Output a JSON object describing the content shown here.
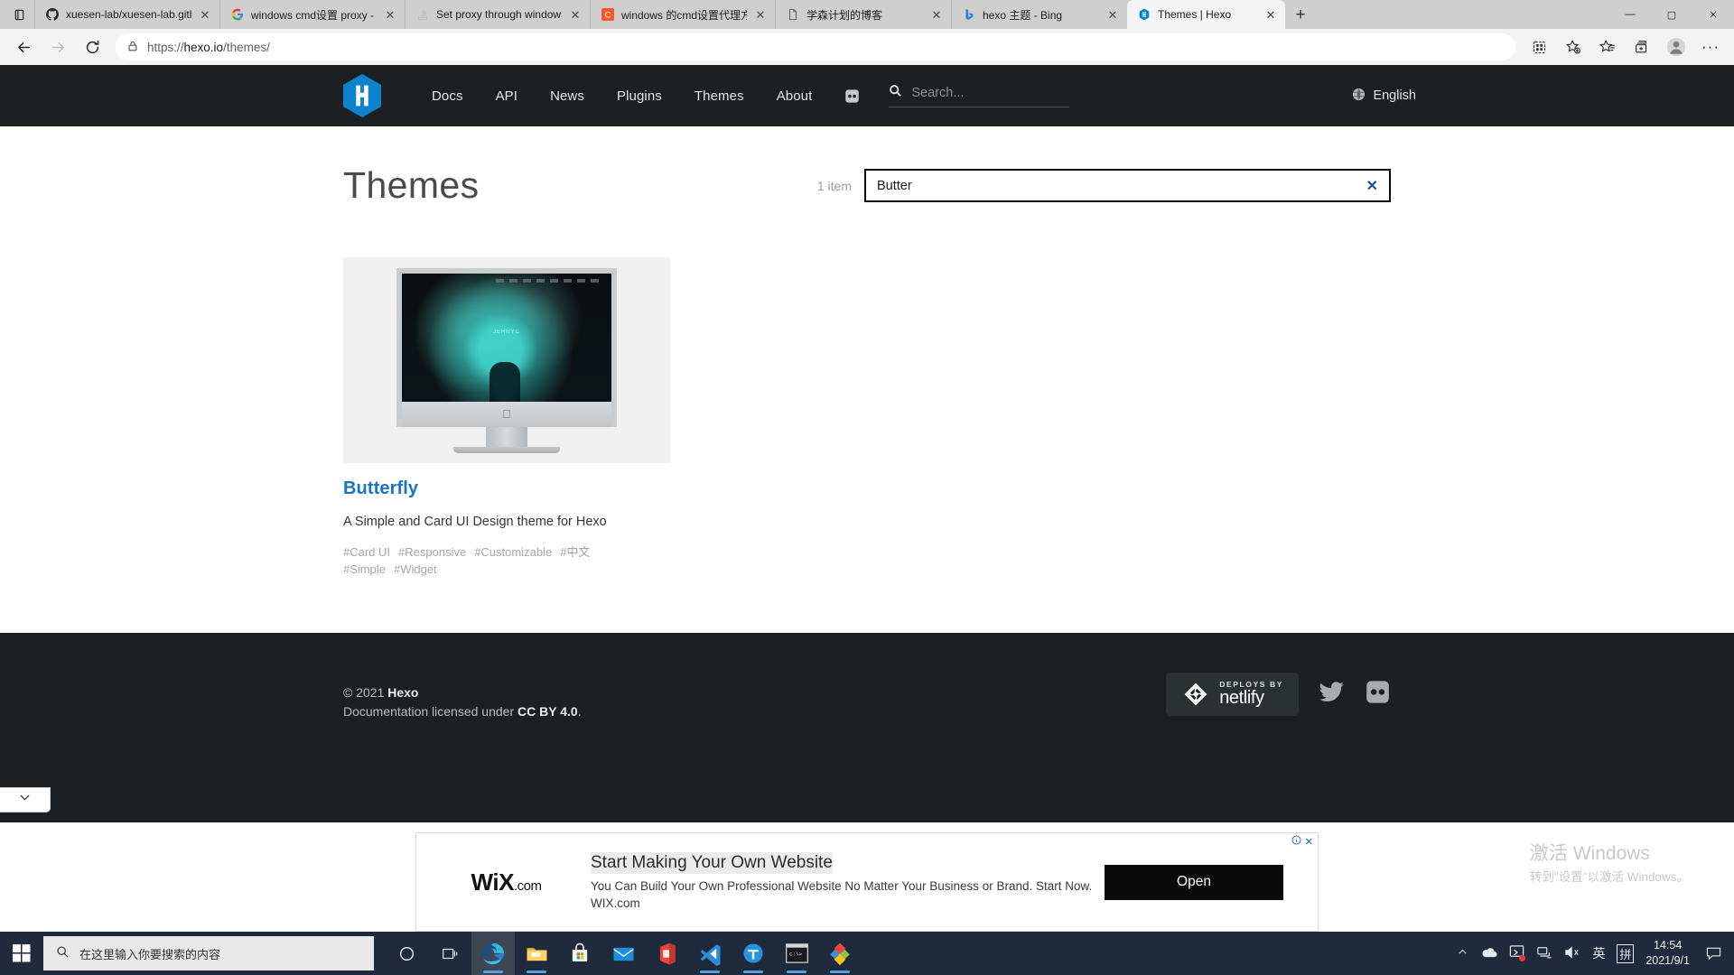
{
  "browser": {
    "tabs": [
      {
        "title": "xuesen-lab/xuesen-lab.github.io",
        "favicon": "github-icon",
        "active": false
      },
      {
        "title": "windows cmd设置 proxy - Goog",
        "favicon": "google-icon",
        "active": false
      },
      {
        "title": "Set proxy through windows com",
        "favicon": "stackoverflow-icon",
        "active": false
      },
      {
        "title": "windows 的cmd设置代理方法_场",
        "favicon": "csdn-icon",
        "active": false
      },
      {
        "title": "学森计划的博客",
        "favicon": "page-icon",
        "active": false
      },
      {
        "title": "hexo 主题 - Bing",
        "favicon": "bing-icon",
        "active": false
      },
      {
        "title": "Themes | Hexo",
        "favicon": "hexo-icon",
        "active": true
      }
    ],
    "newtab_label": "+",
    "window_controls": {
      "minimize": "—",
      "maximize": "▢",
      "close": "✕"
    },
    "toolbar": {
      "back_label": "←",
      "forward_label": "→",
      "reload_label": "⟳",
      "url": "https://hexo.io/themes/",
      "url_host": "hexo.io",
      "url_scheme": "https://",
      "url_path": "/themes/",
      "lock_icon": "lock-icon",
      "right_icons": [
        "collections-grid-icon",
        "add-favorite-icon",
        "favorites-icon",
        "collections-icon",
        "profile-icon",
        "settings-more-icon"
      ],
      "more_label": "···"
    }
  },
  "site": {
    "logo_letter": "H",
    "nav": [
      {
        "label": "Docs"
      },
      {
        "label": "API"
      },
      {
        "label": "News"
      },
      {
        "label": "Plugins"
      },
      {
        "label": "Themes"
      },
      {
        "label": "About"
      }
    ],
    "github_icon": "github-octocat-icon",
    "search_placeholder": "Search...",
    "search_value": "",
    "language": "English",
    "language_icon": "globe-icon"
  },
  "main": {
    "title": "Themes",
    "item_count": "1 item",
    "filter_value": "Butter",
    "filter_clear_label": "✕",
    "cards": [
      {
        "name": "Butterfly",
        "description": "A Simple and Card UI Design theme for Hexo",
        "tags": [
          "#Card UI",
          "#Responsive",
          "#Customizable",
          "#中文",
          "#Simple",
          "#Widget"
        ],
        "thumb_alt": "butterfly-theme-preview"
      }
    ]
  },
  "footer": {
    "copyright_prefix": "© 2021 ",
    "copyright_brand": "Hexo",
    "license_prefix": "Documentation licensed under ",
    "license_name": "CC BY 4.0",
    "license_suffix": ".",
    "netlify_top": "DEPLOYS BY",
    "netlify_bottom": "netlify",
    "social": [
      "twitter-icon",
      "github-icon"
    ]
  },
  "ad": {
    "collapse_icon": "chevron-down-icon",
    "info_icon": "ad-info-icon",
    "close_label": "✕",
    "brand": "WiX",
    "brand_suffix": ".com",
    "headline": "Start Making Your Own Website",
    "description": "You Can Build Your Own Professional Website No Matter Your Business or Brand. Start Now. WIX.com",
    "cta": "Open"
  },
  "watermark": {
    "line1": "激活 Windows",
    "line2": "转到\"设置\"以激活 Windows。"
  },
  "taskbar": {
    "start_icon": "windows-start-icon",
    "search_placeholder": "在这里输入你要搜索的内容",
    "search_icon": "search-icon",
    "cortana_icon": "cortana-icon",
    "taskview_icon": "task-view-icon",
    "apps": [
      {
        "icon": "edge-icon",
        "active": true
      },
      {
        "icon": "file-explorer-icon",
        "active": true
      },
      {
        "icon": "microsoft-store-icon",
        "active": false
      },
      {
        "icon": "mail-icon",
        "active": false
      },
      {
        "icon": "office-icon",
        "active": false
      },
      {
        "icon": "vscode-icon",
        "active": true
      },
      {
        "icon": "typora-icon",
        "active": true
      },
      {
        "icon": "cmd-icon",
        "active": true
      },
      {
        "icon": "everything-icon",
        "active": true
      }
    ],
    "tray": {
      "overflow_icon": "chevron-up-icon",
      "onedrive_icon": "onedrive-icon",
      "update_icon": "windows-update-icon",
      "network_icon": "network-icon",
      "volume_icon": "volume-muted-icon",
      "ime_lang": "英",
      "ime_mode": "拼",
      "time": "14:54",
      "date": "2021/9/1",
      "notification_icon": "notification-icon"
    }
  }
}
